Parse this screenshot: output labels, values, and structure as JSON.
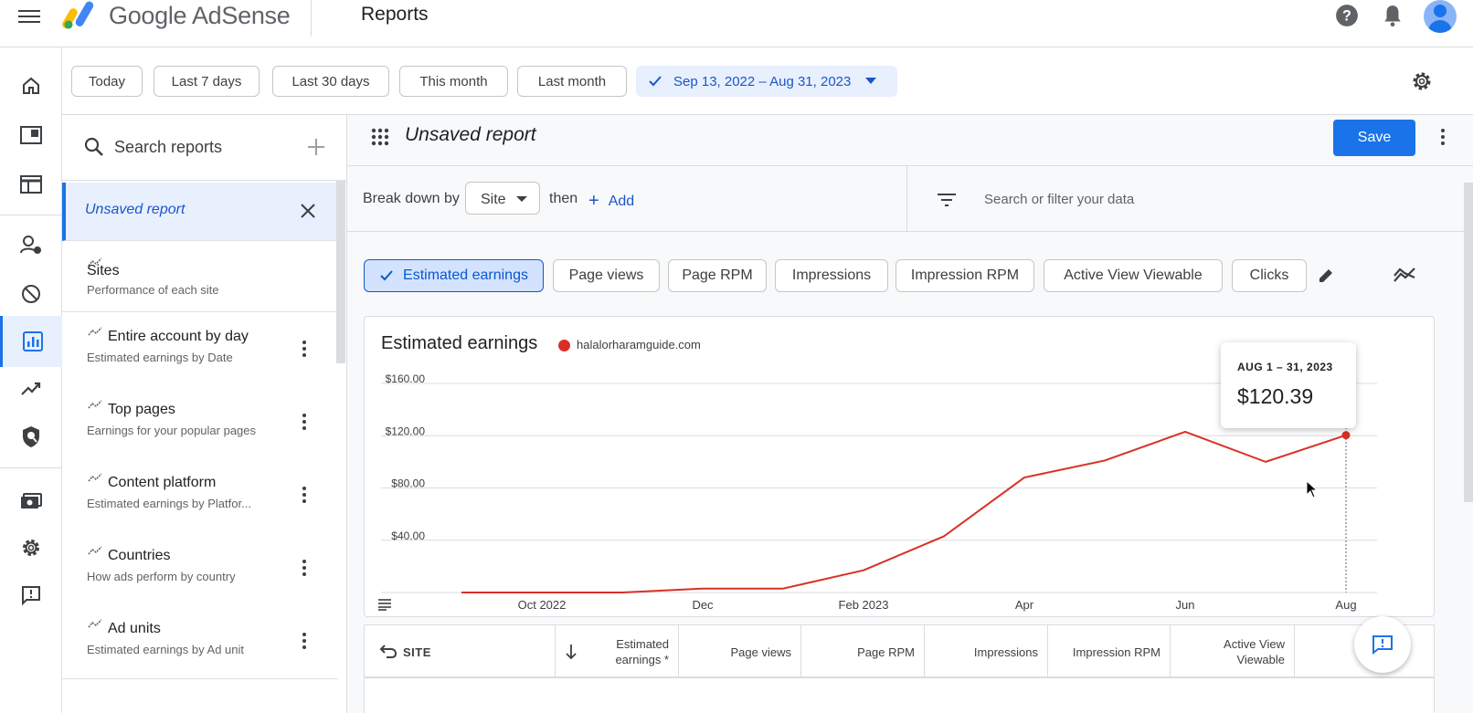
{
  "header": {
    "app_name": "Google AdSense",
    "page_title": "Reports",
    "icons": [
      "menu-icon",
      "help-icon",
      "notifications-icon",
      "account-avatar"
    ]
  },
  "left_nav": {
    "items": [
      "home-icon",
      "ads-icon",
      "sites-icon",
      "privacy-messaging-icon",
      "blocking-controls-icon",
      "reports-icon",
      "optimization-icon",
      "policy-center-icon",
      "payments-icon",
      "settings-icon",
      "feedback-icon"
    ],
    "active": "reports-icon"
  },
  "date_range": {
    "presets": [
      "Today",
      "Last 7 days",
      "Last 30 days",
      "This month",
      "Last month"
    ],
    "selected_range": "Sep 13, 2022 – Aug 31, 2023"
  },
  "reports_panel": {
    "search_placeholder": "Search reports",
    "current": "Unsaved report",
    "items": [
      {
        "title": "Sites",
        "subtitle": "Performance of each site"
      },
      {
        "title": "Entire account by day",
        "subtitle": "Estimated earnings by Date"
      },
      {
        "title": "Top pages",
        "subtitle": "Earnings for your popular pages"
      },
      {
        "title": "Content platform",
        "subtitle": "Estimated earnings by Platfor..."
      },
      {
        "title": "Countries",
        "subtitle": "How ads perform by country"
      },
      {
        "title": "Ad units",
        "subtitle": "Estimated earnings by Ad unit"
      }
    ]
  },
  "report": {
    "name": "Unsaved report",
    "save_label": "Save",
    "breakdown_label": "Break down by",
    "breakdown_value": "Site",
    "then_label": "then",
    "add_label": "Add",
    "filter_placeholder": "Search or filter your data"
  },
  "metrics": [
    {
      "label": "Estimated earnings",
      "selected": true
    },
    {
      "label": "Page views",
      "selected": false
    },
    {
      "label": "Page RPM",
      "selected": false
    },
    {
      "label": "Impressions",
      "selected": false
    },
    {
      "label": "Impression RPM",
      "selected": false
    },
    {
      "label": "Active View Viewable",
      "selected": false
    },
    {
      "label": "Clicks",
      "selected": false
    }
  ],
  "chart_data": {
    "type": "line",
    "title": "Estimated earnings",
    "series": [
      {
        "name": "halalorharamguide.com",
        "color": "#d93025",
        "x": [
          "2022-09",
          "2022-10",
          "2022-11",
          "2022-12",
          "2023-01",
          "2023-02",
          "2023-03",
          "2023-04",
          "2023-05",
          "2023-06",
          "2023-07",
          "2023-08"
        ],
        "values": [
          0,
          0,
          0,
          3,
          3,
          17,
          43,
          88,
          101,
          123,
          100,
          120.39
        ]
      }
    ],
    "x_ticks": [
      "Oct 2022",
      "Dec",
      "Feb 2023",
      "Apr",
      "Jun",
      "Aug"
    ],
    "y_ticks": [
      "$40.00",
      "$80.00",
      "$120.00",
      "$160.00"
    ],
    "ylim": [
      0,
      160
    ],
    "grid": true,
    "tooltip": {
      "date": "AUG 1 – 31, 2023",
      "value": "$120.39"
    }
  },
  "table": {
    "columns": [
      "SITE",
      "Estimated earnings *",
      "Page views",
      "Page RPM",
      "Impressions",
      "Impression RPM",
      "Active View Viewable"
    ]
  }
}
